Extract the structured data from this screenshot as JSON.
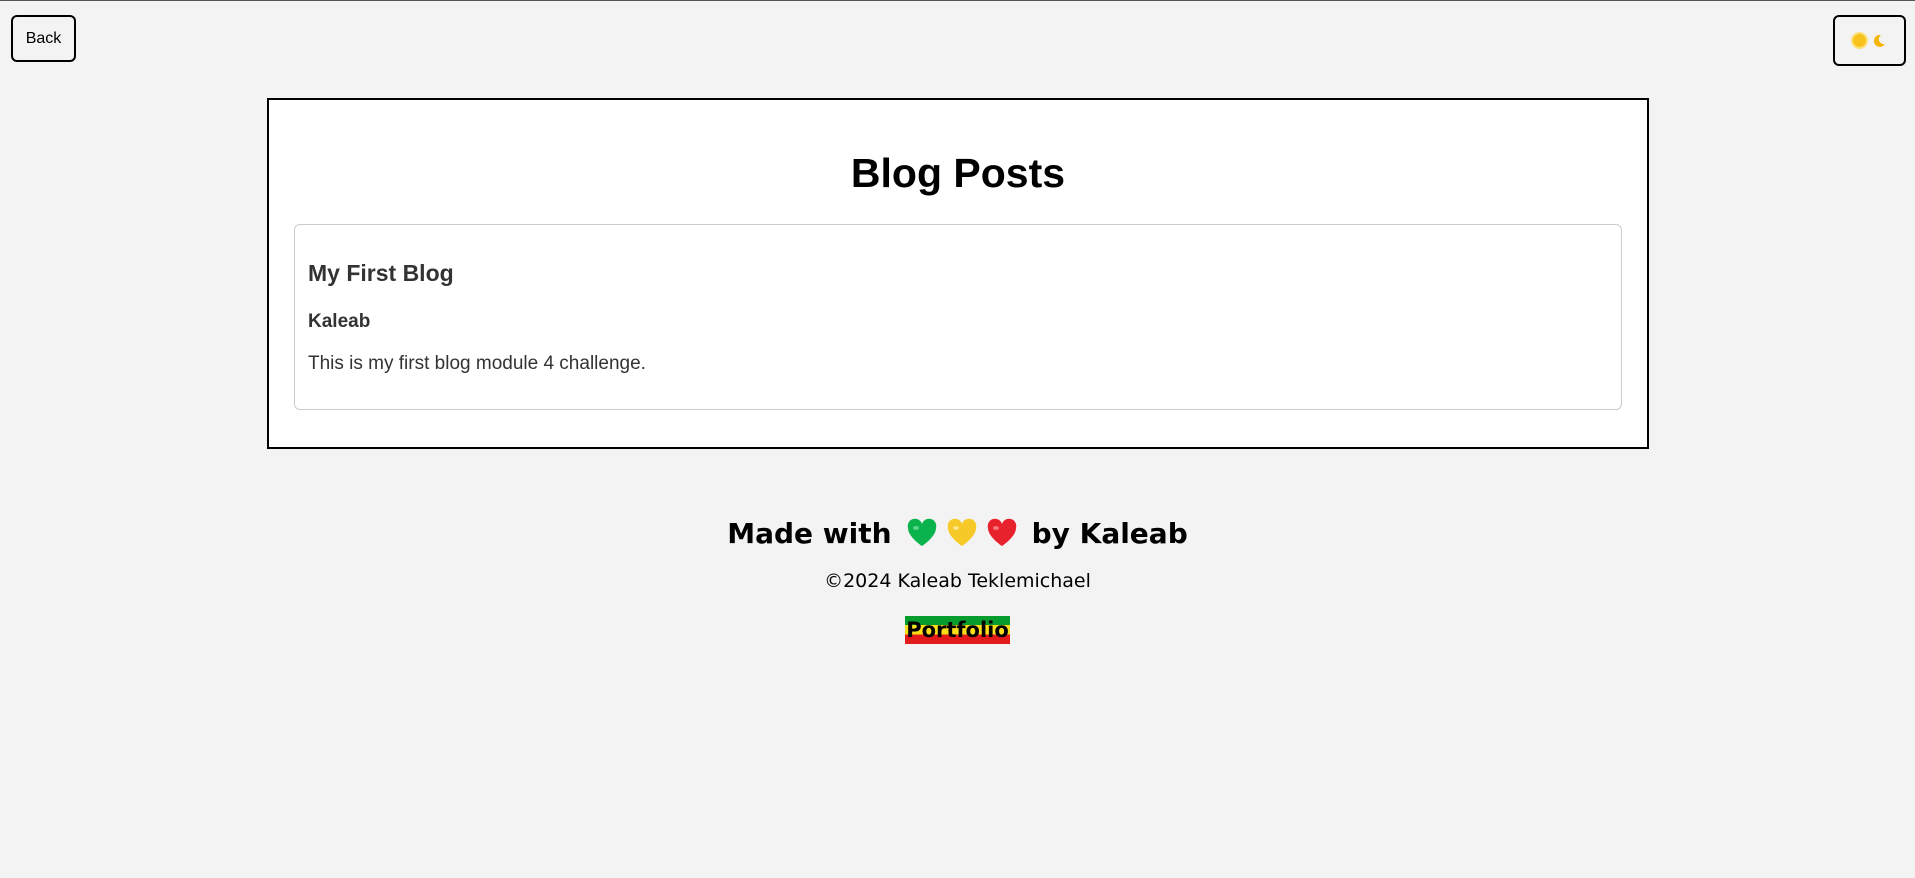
{
  "nav": {
    "back_label": "Back",
    "theme_toggle_icons": [
      "sun-icon",
      "moon-icon"
    ]
  },
  "main": {
    "title": "Blog Posts",
    "posts": [
      {
        "title": "My First Blog",
        "author": "Kaleab",
        "content": "This is my first blog module 4 challenge."
      }
    ]
  },
  "footer": {
    "made_with_prefix": "Made with",
    "made_with_suffix": "by Kaleab",
    "hearts": [
      {
        "icon": "green-heart-icon",
        "color": "#0bb34d"
      },
      {
        "icon": "yellow-heart-icon",
        "color": "#f7c928"
      },
      {
        "icon": "red-heart-icon",
        "color": "#e8222c"
      }
    ],
    "copyright": "©2024 Kaleab Teklemichael",
    "portfolio_label": "Portfolio"
  },
  "colors": {
    "background": "#f3f3f3",
    "panel": "#ffffff",
    "portfolio_gradient": [
      "#079c2e",
      "#f9dd16",
      "#e21a1a"
    ]
  }
}
